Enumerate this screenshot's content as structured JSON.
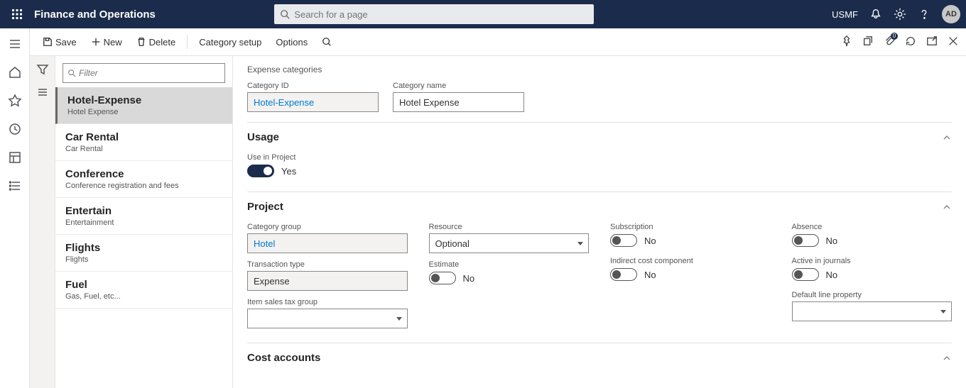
{
  "header": {
    "app_name": "Finance and Operations",
    "search_placeholder": "Search for a page",
    "company": "USMF",
    "avatar_initials": "AD"
  },
  "toolbar": {
    "save": "Save",
    "new": "New",
    "delete": "Delete",
    "category_setup": "Category setup",
    "options": "Options",
    "attach_badge": "0"
  },
  "list": {
    "filter_placeholder": "Filter",
    "items": [
      {
        "title": "Hotel-Expense",
        "subtitle": "Hotel Expense"
      },
      {
        "title": "Car Rental",
        "subtitle": "Car Rental"
      },
      {
        "title": "Conference",
        "subtitle": "Conference registration and fees"
      },
      {
        "title": "Entertain",
        "subtitle": "Entertainment"
      },
      {
        "title": "Flights",
        "subtitle": "Flights"
      },
      {
        "title": "Fuel",
        "subtitle": "Gas, Fuel, etc..."
      }
    ],
    "selected_index": 0
  },
  "form": {
    "page_title": "Expense categories",
    "category_id_label": "Category ID",
    "category_id_value": "Hotel-Expense",
    "category_name_label": "Category name",
    "category_name_value": "Hotel Expense",
    "sections": {
      "usage": {
        "title": "Usage",
        "use_in_project_label": "Use in Project",
        "use_in_project_value": true,
        "yes": "Yes"
      },
      "project": {
        "title": "Project",
        "category_group_label": "Category group",
        "category_group_value": "Hotel",
        "transaction_type_label": "Transaction type",
        "transaction_type_value": "Expense",
        "item_sales_tax_label": "Item sales tax group",
        "item_sales_tax_value": "",
        "resource_label": "Resource",
        "resource_value": "Optional",
        "estimate_label": "Estimate",
        "estimate_value": false,
        "subscription_label": "Subscription",
        "subscription_value": false,
        "indirect_label": "Indirect cost component",
        "indirect_value": false,
        "absence_label": "Absence",
        "absence_value": false,
        "active_label": "Active in journals",
        "active_value": false,
        "default_line_label": "Default line property",
        "default_line_value": "",
        "no": "No"
      },
      "cost_accounts": {
        "title": "Cost accounts"
      }
    }
  }
}
